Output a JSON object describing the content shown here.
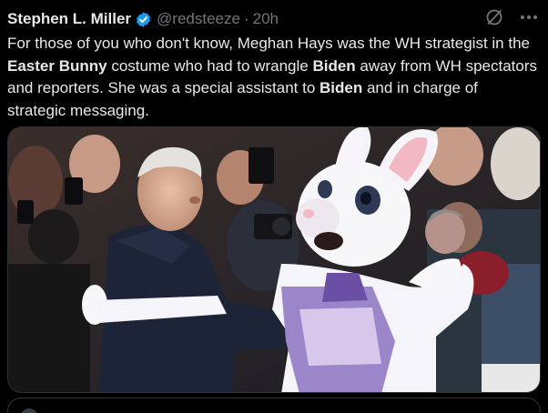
{
  "tweet": {
    "author_name": "Stephen L. Miller",
    "handle": "@redsteeze",
    "separator": "·",
    "time": "20h",
    "body": {
      "t1": "For those of you who don't know, Meghan Hays was the WH strategist in the ",
      "b1": "Easter Bunny",
      "t2": " costume who had to wrangle ",
      "b2": "Biden",
      "t3": " away from WH spectators and reporters. She was a special assistant to ",
      "b3": "Biden",
      "t4": " and in charge of strategic messaging."
    }
  },
  "icons": {
    "verified": "verified-badge-icon",
    "grok": "grok-slash-circle-icon",
    "more": "more-dots-icon",
    "media": "photo-easter-bunny-and-biden"
  },
  "colors": {
    "background": "#000000",
    "primary_text": "#e7e9ea",
    "secondary_text": "#71767b",
    "verified_blue": "#1d9bf0",
    "border": "#2f3336"
  }
}
